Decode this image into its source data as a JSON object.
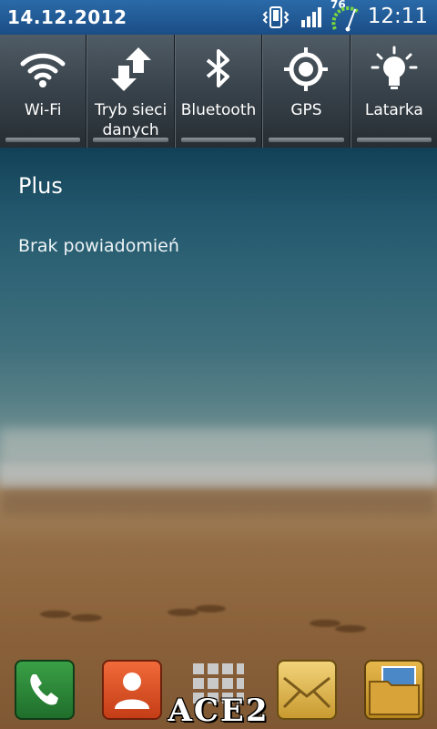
{
  "status_bar": {
    "date": "14.12.2012",
    "time": "12:11",
    "battery_level": "76",
    "icons": [
      "vibrate-icon",
      "signal-icon",
      "battery-icon"
    ]
  },
  "quick_settings": [
    {
      "label": "Wi-Fi",
      "icon": "wifi-icon"
    },
    {
      "label": "Tryb sieci danych",
      "icon": "data-mode-icon"
    },
    {
      "label": "Bluetooth",
      "icon": "bluetooth-icon"
    },
    {
      "label": "GPS",
      "icon": "gps-icon"
    },
    {
      "label": "Latarka",
      "icon": "flashlight-icon"
    }
  ],
  "notifications": {
    "operator": "Plus",
    "empty_text": "Brak powiadomień"
  },
  "dock": {
    "apps": [
      "phone-icon",
      "contacts-icon",
      "apps-grid-icon",
      "messages-icon",
      "files-icon"
    ],
    "watermark": "ACE2"
  },
  "colors": {
    "status_bar": "#1a4d86",
    "panel": "#3a444c"
  }
}
